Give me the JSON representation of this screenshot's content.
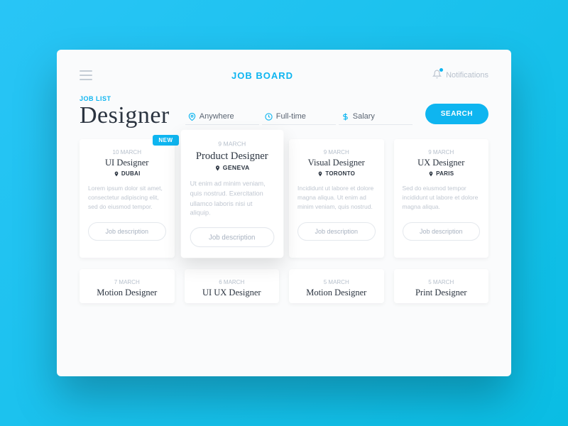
{
  "header": {
    "logo": "JOB BOARD",
    "notifications_label": "Notifications"
  },
  "list": {
    "subtitle": "JOB LIST",
    "title": "Designer",
    "filters": {
      "location": "Anywhere",
      "type": "Full-time",
      "salary": "Salary"
    },
    "search_label": "SEARCH"
  },
  "badge_new": "NEW",
  "cta_label": "Job description",
  "jobs_row1": [
    {
      "date": "10 MARCH",
      "title": "UI Designer",
      "location": "DUBAI",
      "desc": "Lorem ipsum dolor sit amet, consectetur adipiscing elit, sed do eiusmod tempor."
    },
    {
      "date": "9 MARCH",
      "title": "Product Designer",
      "location": "GENEVA",
      "desc": "Ut enim ad minim veniam, quis nostrud. Exercitation ullamco laboris nisi ut aliquip."
    },
    {
      "date": "9 MARCH",
      "title": "Visual Designer",
      "location": "TORONTO",
      "desc": "Incididunt ut labore et dolore magna aliqua. Ut enim ad minim veniam, quis nostrud."
    },
    {
      "date": "9 MARCH",
      "title": "UX Designer",
      "location": "PARIS",
      "desc": "Sed do eiusmod tempor incididunt ut labore et dolore magna aliqua."
    }
  ],
  "jobs_row2": [
    {
      "date": "7 MARCH",
      "title": "Motion Designer"
    },
    {
      "date": "6 MARCH",
      "title": "UI UX Designer"
    },
    {
      "date": "5 MARCH",
      "title": "Motion Designer"
    },
    {
      "date": "5 MARCH",
      "title": "Print Designer"
    }
  ]
}
